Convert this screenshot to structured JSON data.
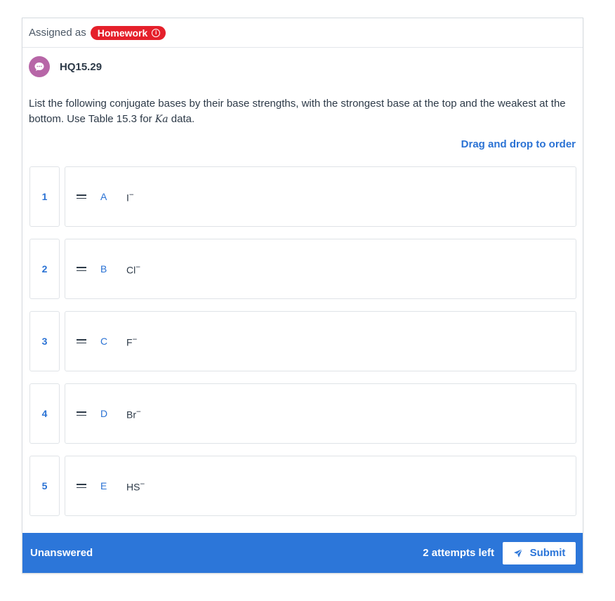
{
  "assignment": {
    "label": "Assigned as",
    "type_badge": "Homework"
  },
  "question": {
    "id": "HQ15.29",
    "prompt_before": "List the following conjugate bases by their base strengths, with the strongest base at the top and the weakest at the bottom. Use Table 15.3 for ",
    "prompt_var": "Ka",
    "prompt_after": " data."
  },
  "order_hint": "Drag and drop to order",
  "positions": [
    "1",
    "2",
    "3",
    "4",
    "5"
  ],
  "items": [
    {
      "letter": "A",
      "ion": "I",
      "charge": "−"
    },
    {
      "letter": "B",
      "ion": "Cl",
      "charge": "−"
    },
    {
      "letter": "C",
      "ion": "F",
      "charge": "−"
    },
    {
      "letter": "D",
      "ion": "Br",
      "charge": "−"
    },
    {
      "letter": "E",
      "ion": "HS",
      "charge": "−"
    }
  ],
  "footer": {
    "status": "Unanswered",
    "attempts": "2 attempts left",
    "submit_label": "Submit"
  },
  "colors": {
    "accent": "#2c76d9",
    "badge": "#e5202b",
    "avatar": "#b766a7"
  },
  "icons": {
    "info": "info-icon",
    "chat": "chat-bubble-icon",
    "grip": "drag-handle-icon",
    "send": "paper-plane-icon"
  }
}
